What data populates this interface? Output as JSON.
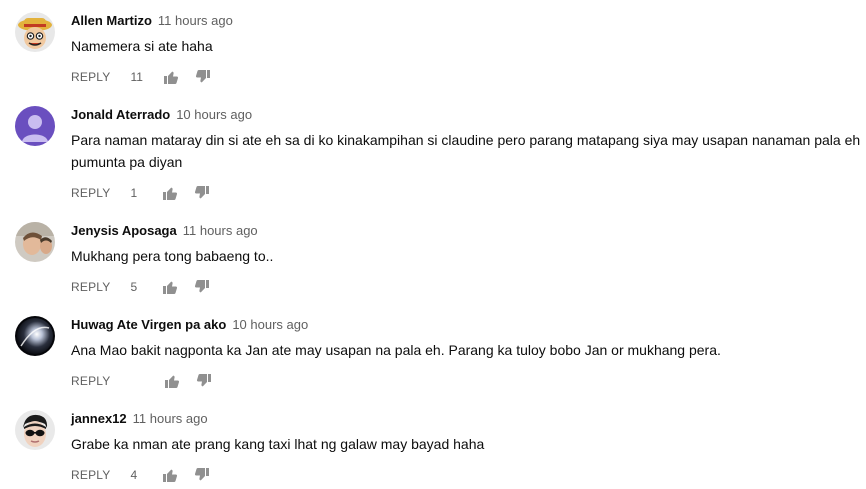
{
  "reply_label": "REPLY",
  "comments": [
    {
      "author": "Allen Martizo",
      "time": "11 hours ago",
      "text": "Namemera si ate haha",
      "likes": "11",
      "avatar_icon": "cartoon-straw-hat-avatar"
    },
    {
      "author": "Jonald Aterrado",
      "time": "10 hours ago",
      "text": "Para naman mataray din si ate eh sa di ko kinakampihan si claudine pero parang matapang siya may usapan nanaman pala eh pumunta pa diyan",
      "likes": "1",
      "avatar_icon": "default-person-avatar"
    },
    {
      "author": "Jenysis Aposaga",
      "time": "11 hours ago",
      "text": "Mukhang pera tong babaeng to..",
      "likes": "5",
      "avatar_icon": "photo-avatar"
    },
    {
      "author": "Huwag Ate Virgen pa ako",
      "time": "10 hours ago",
      "text": "Ana Mao bakit nagponta ka Jan ate may usapan na pala eh. Parang ka tuloy bobo Jan or mukhang pera.",
      "likes": "",
      "avatar_icon": "dark-moon-avatar"
    },
    {
      "author": "jannex12",
      "time": "11 hours ago",
      "text": "Grabe ka nman ate prang kang taxi lhat ng galaw may bayad haha",
      "likes": "4",
      "avatar_icon": "sunglasses-person-avatar"
    }
  ],
  "colors": {
    "author": "#0d0d0d",
    "secondary": "#606060",
    "default_avatar_bg": "#6a4fbf"
  }
}
